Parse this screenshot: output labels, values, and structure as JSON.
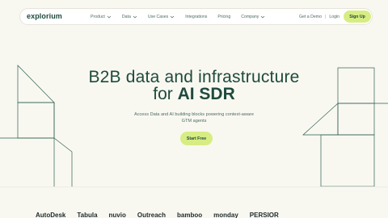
{
  "nav": {
    "logo": "explorium",
    "menu": [
      {
        "label": "Product",
        "has_dropdown": true
      },
      {
        "label": "Data",
        "has_dropdown": true
      },
      {
        "label": "Use Cases",
        "has_dropdown": true
      },
      {
        "label": "Integrations",
        "has_dropdown": false
      },
      {
        "label": "Pricing",
        "has_dropdown": false
      },
      {
        "label": "Company",
        "has_dropdown": true
      }
    ],
    "get_demo": "Get a Demo",
    "separator": "|",
    "login": "Login",
    "signup": "Sign Up"
  },
  "hero": {
    "title_line1": "B2B data and infrastructure",
    "title_line2_prefix": "for ",
    "title_line2_bold": "AI SDR",
    "subtitle_line1": "Access Data and AI building blocks powering context-aware",
    "subtitle_line2": "GTM agents",
    "cta": "Start Free"
  },
  "brands": [
    "AutoDesk",
    "Tabula",
    "nuvio",
    "Outreach",
    "bamboo",
    "monday",
    "PERSIOR"
  ],
  "colors": {
    "background": "#f8f8f1",
    "primary_text": "#1f4a3d",
    "accent": "#d7ed83"
  }
}
